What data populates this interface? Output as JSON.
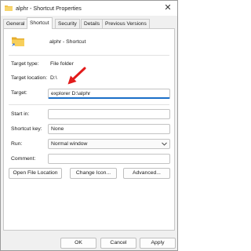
{
  "window": {
    "title": "alphr - Shortcut Properties",
    "close_glyph": "✕"
  },
  "tabs": [
    {
      "label": "General",
      "active": false
    },
    {
      "label": "Shortcut",
      "active": true
    },
    {
      "label": "Security",
      "active": false
    },
    {
      "label": "Details",
      "active": false
    },
    {
      "label": "Previous Versions",
      "active": false
    }
  ],
  "shortcut": {
    "name": "alphr - Shortcut",
    "fields": {
      "target_type_label": "Target type:",
      "target_type_value": "File folder",
      "target_location_label": "Target location:",
      "target_location_value": "D:\\",
      "target_label": "Target:",
      "target_value": "explorer D:\\alphr",
      "start_in_label": "Start in:",
      "start_in_value": "",
      "shortcut_key_label": "Shortcut key:",
      "shortcut_key_value": "None",
      "run_label": "Run:",
      "run_value": "Normal window",
      "comment_label": "Comment:",
      "comment_value": ""
    },
    "buttons": {
      "open_file_location": "Open File Location",
      "change_icon": "Change Icon...",
      "advanced": "Advanced..."
    }
  },
  "footer": {
    "ok": "OK",
    "cancel": "Cancel",
    "apply": "Apply"
  },
  "icons": {
    "folder": "folder-icon",
    "chevron": "chevron-down-icon",
    "close": "close-icon",
    "annotation_arrow": "arrow-icon"
  },
  "colors": {
    "folder_yellow": "#f2c34b",
    "focus_blue": "#1a6ec8",
    "arrow_red": "#e21b1b"
  }
}
